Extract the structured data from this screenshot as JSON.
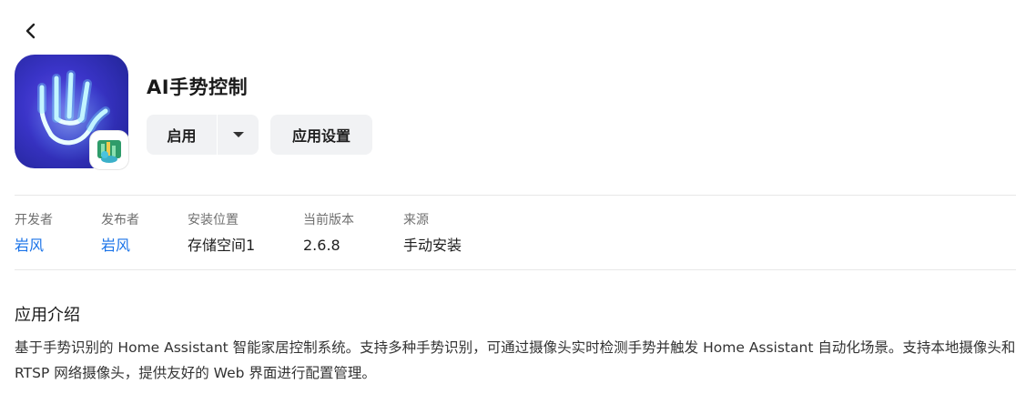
{
  "icons": {
    "back": "chevron-left-icon",
    "dropdown": "caret-down-icon",
    "app": "hand-gesture-app-icon",
    "badge": "home-assistant-badge-icon"
  },
  "colors": {
    "link": "#1a73e8",
    "button_bg": "#f1f2f4",
    "icon_bg": "#3a34c8",
    "divider": "#e8e8e8"
  },
  "app": {
    "title": "AI手势控制"
  },
  "actions": {
    "enable_label": "启用",
    "settings_label": "应用设置"
  },
  "meta": [
    {
      "label": "开发者",
      "value": "岩风",
      "link": true
    },
    {
      "label": "发布者",
      "value": "岩风",
      "link": true
    },
    {
      "label": "安装位置",
      "value": "存储空间1",
      "link": false
    },
    {
      "label": "当前版本",
      "value": "2.6.8",
      "link": false
    },
    {
      "label": "来源",
      "value": "手动安装",
      "link": false
    }
  ],
  "intro": {
    "title": "应用介绍",
    "text": "基于手势识别的 Home Assistant 智能家居控制系统。支持多种手势识别，可通过摄像头实时检测手势并触发 Home Assistant 自动化场景。支持本地摄像头和 RTSP 网络摄像头，提供友好的 Web 界面进行配置管理。"
  }
}
